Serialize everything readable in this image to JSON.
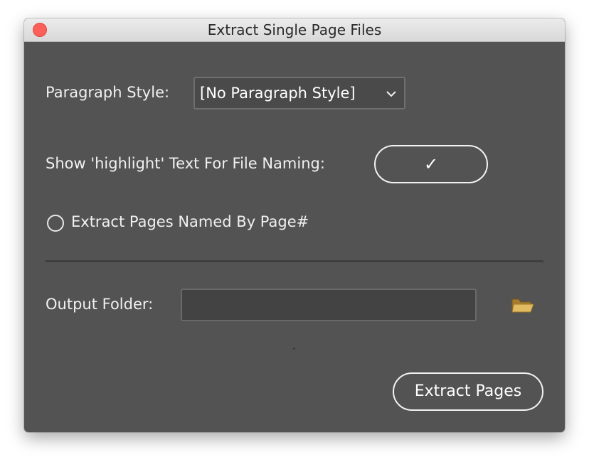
{
  "window": {
    "title": "Extract Single Page Files"
  },
  "paragraph_style": {
    "label": "Paragraph Style:",
    "selected": "[No Paragraph Style]"
  },
  "highlight": {
    "label": "Show 'highlight' Text For File Naming:",
    "checkmark": "✓"
  },
  "page_number_option": {
    "label": "Extract Pages Named By Page#",
    "selected": false
  },
  "output_folder": {
    "label": "Output Folder:",
    "value": ""
  },
  "actions": {
    "extract_label": "Extract Pages"
  },
  "icons": {
    "close": "close-icon",
    "dropdown": "chevron-down-icon",
    "folder": "folder-icon"
  },
  "colors": {
    "panel": "#535353",
    "close": "#fc605b",
    "folder": "#d9b45c"
  }
}
